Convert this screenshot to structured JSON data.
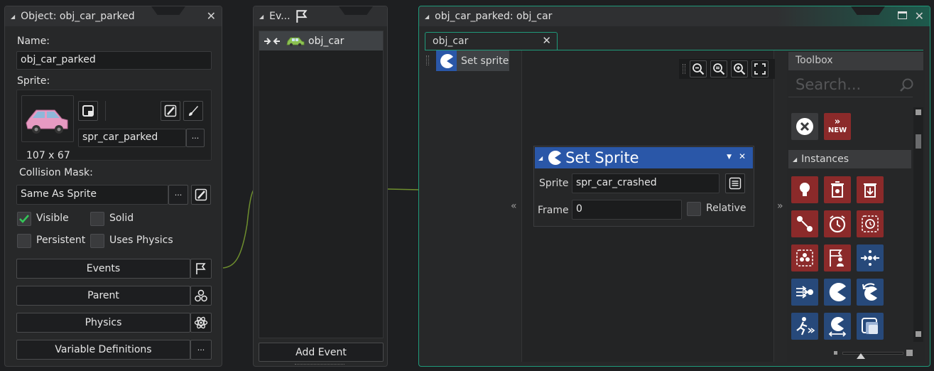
{
  "object_panel": {
    "title": "Object: obj_car_parked",
    "name_label": "Name:",
    "name_value": "obj_car_parked",
    "sprite_label": "Sprite:",
    "sprite_value": "spr_car_parked",
    "sprite_size": "107 x 67",
    "collision_label": "Collision Mask:",
    "collision_value": "Same As Sprite",
    "more_label": "···",
    "checkboxes": {
      "visible": "Visible",
      "solid": "Solid",
      "persistent": "Persistent",
      "uses_physics": "Uses Physics"
    },
    "buttons": {
      "events": "Events",
      "parent": "Parent",
      "physics": "Physics",
      "variable_definitions": "Variable Definitions"
    }
  },
  "events_panel": {
    "title": "Ev...",
    "event_item": "obj_car",
    "add_event": "Add Event"
  },
  "editor_panel": {
    "title": "obj_car_parked: obj_car",
    "tab_label": "obj_car",
    "action_list_item": "Set sprite",
    "collapse_left": "«",
    "collapse_right": "»",
    "node": {
      "title": "Set Sprite",
      "sprite_label": "Sprite",
      "sprite_value": "spr_car_crashed",
      "frame_label": "Frame",
      "frame_value": "0",
      "relative_label": "Relative"
    },
    "toolbox": {
      "title": "Toolbox",
      "search_placeholder": "Search...",
      "new_label": "NEW",
      "section": "Instances"
    }
  },
  "colors": {
    "accent_green": "#1f9a7a",
    "node_blue": "#2a57a8",
    "toolbox_red": "#8b2a2a",
    "toolbox_blue": "#27497a",
    "check_green": "#34c759"
  }
}
